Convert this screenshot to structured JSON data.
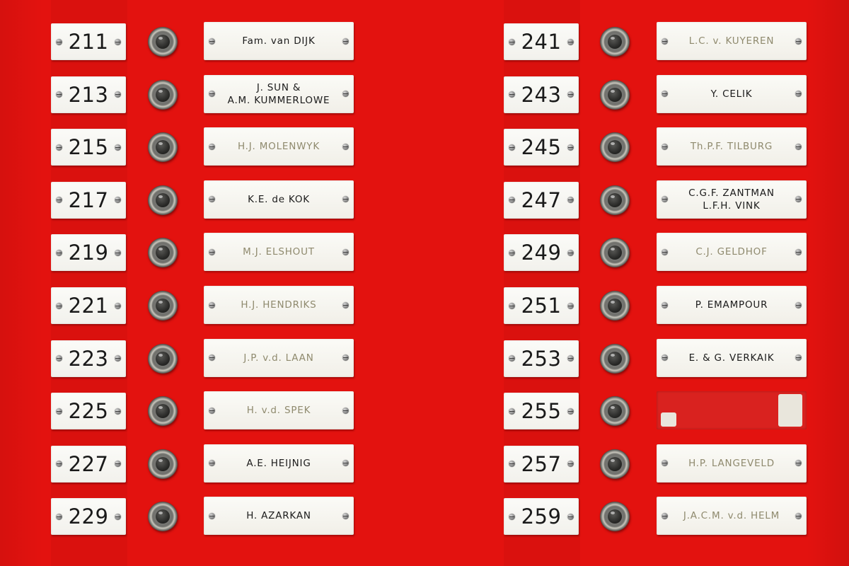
{
  "left_column": [
    {
      "number": "211",
      "name": "Fam. van DIJK",
      "faded": false
    },
    {
      "number": "213",
      "name": "J. SUN &\nA.M. KUMMERLOWE",
      "faded": false
    },
    {
      "number": "215",
      "name": "H.J. MOLENWYK",
      "faded": true
    },
    {
      "number": "217",
      "name": "K.E. de KOK",
      "faded": false
    },
    {
      "number": "219",
      "name": "M.J. ELSHOUT",
      "faded": true
    },
    {
      "number": "221",
      "name": "H.J. HENDRIKS",
      "faded": true
    },
    {
      "number": "223",
      "name": "J.P. v.d. LAAN",
      "faded": true
    },
    {
      "number": "225",
      "name": "H. v.d. SPEK",
      "faded": true
    },
    {
      "number": "227",
      "name": "A.E. HEIJNIG",
      "faded": false
    },
    {
      "number": "229",
      "name": "H. AZARKAN",
      "faded": false
    }
  ],
  "right_column": [
    {
      "number": "241",
      "name": "L.C. v. KUYEREN",
      "faded": true
    },
    {
      "number": "243",
      "name": "Y. CELIK",
      "faded": false
    },
    {
      "number": "245",
      "name": "Th.P.F. TILBURG",
      "faded": true
    },
    {
      "number": "247",
      "name": "C.G.F. ZANTMAN\nL.F.H. VINK",
      "faded": false
    },
    {
      "number": "249",
      "name": "C.J. GELDHOF",
      "faded": true
    },
    {
      "number": "251",
      "name": "P. EMAMPOUR",
      "faded": false
    },
    {
      "number": "253",
      "name": "E. & G. VERKAIK",
      "faded": false
    },
    {
      "number": "255",
      "name": "",
      "faded": false,
      "damaged": true
    },
    {
      "number": "257",
      "name": "H.P. LANGEVELD",
      "faded": true
    },
    {
      "number": "259",
      "name": "J.A.C.M. v.d. HELM",
      "faded": true
    }
  ],
  "colors": {
    "panel_red": "#e3120f",
    "plate_white": "#f6f5f0",
    "text_dark": "#1b1b1b",
    "text_faded": "#8f8a6e"
  }
}
